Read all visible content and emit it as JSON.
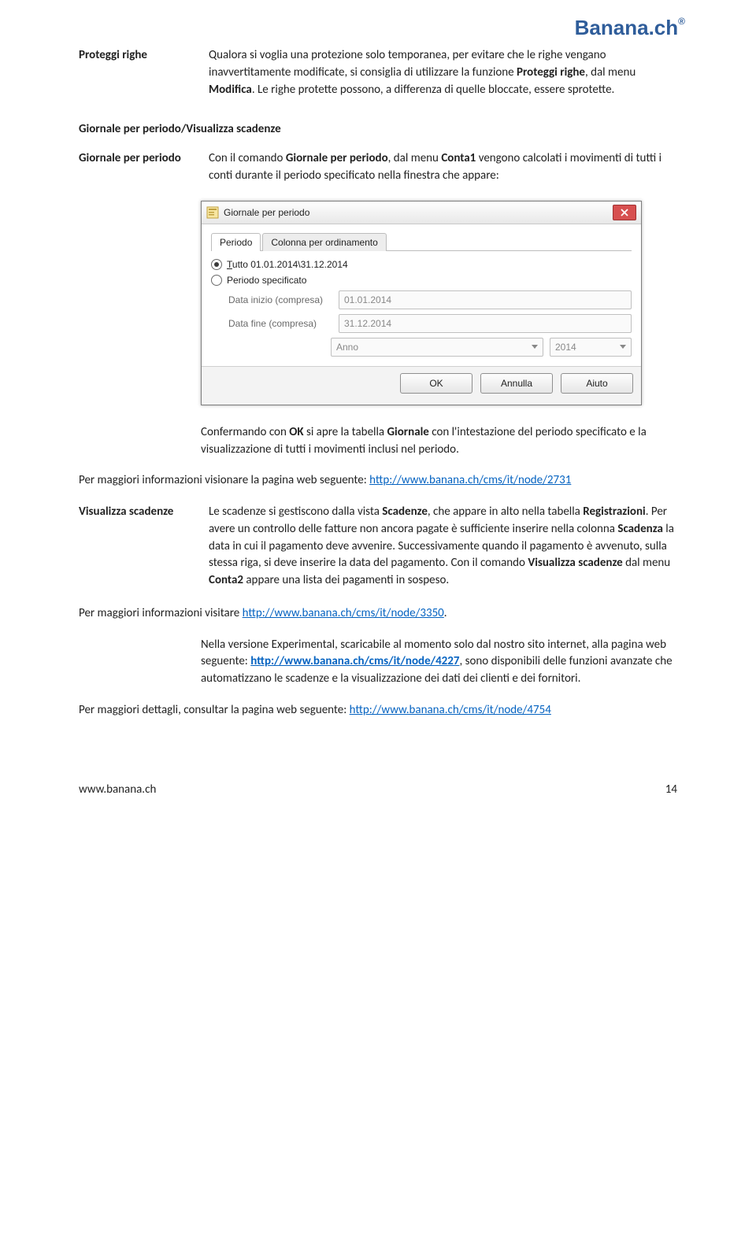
{
  "brand": {
    "name": "Banana.ch",
    "reg": "®"
  },
  "entry1": {
    "label": "Proteggi righe",
    "body_a": "Qualora si voglia una protezione solo temporanea, per evitare che le righe vengano inavvertitamente modificate, si consiglia di utilizzare la funzione ",
    "bold_a": "Proteggi righe",
    "body_b": ", dal menu ",
    "bold_b": "Modifica",
    "body_c": ". Le righe protette possono, a differenza di quelle bloccate, essere sprotette."
  },
  "section_title": "Giornale per periodo/Visualizza scadenze",
  "entry2": {
    "label": "Giornale per periodo",
    "a": "Con il comando ",
    "b1": "Giornale per periodo",
    "b": ", dal menu ",
    "b2": "Conta1",
    "c": " vengono calcolati i movimenti di tutti i conti durante il periodo specificato nella finestra che appare:"
  },
  "dialog": {
    "title": "Giornale per periodo",
    "tab1": "Periodo",
    "tab2": "Colonna per ordinamento",
    "radio_tutto_prefix": "T",
    "radio_tutto_rest": "utto 01.01.2014\\31.12.2014",
    "radio_periodo": "Periodo specificato",
    "data_inizio_label": "Data inizio (compresa)",
    "data_inizio_value": "01.01.2014",
    "data_fine_label": "Data fine (compresa)",
    "data_fine_value": "31.12.2014",
    "combo_period": "Anno",
    "combo_year": "2014",
    "ok": "OK",
    "annulla": "Annulla",
    "aiuto": "Aiuto"
  },
  "after_dialog": {
    "a": "Confermando con ",
    "b1": "OK",
    "b": " si apre la tabella ",
    "b2": "Giornale",
    "c": " con l'intestazione del periodo specificato e la visualizzazione di tutti i movimenti inclusi nel periodo."
  },
  "info_line1": {
    "pre": "Per maggiori informazioni visionare la pagina web seguente: ",
    "link": "http://www.banana.ch/cms/it/node/2731"
  },
  "entry3": {
    "label": "Visualizza scadenze",
    "a": "Le scadenze si gestiscono dalla vista ",
    "b1": "Scadenze",
    "b": ", che appare in alto nella tabella ",
    "b2": "Registrazioni",
    "c": ". Per avere un controllo delle fatture non ancora pagate è sufficiente inserire nella colonna ",
    "b3": "Scadenza",
    "d": " la data in cui il pagamento deve avvenire. Successivamente quando il pagamento è avvenuto, sulla stessa riga, si deve inserire la data del pagamento. Con il comando ",
    "b4": "Visualizza scadenze",
    "e": " dal menu ",
    "b5": "Conta2",
    "f": " appare una lista dei pagamenti in sospeso."
  },
  "info_line2": {
    "pre": "Per maggiori informazioni visitare ",
    "link": "http://www.banana.ch/cms/it/node/3350",
    "suf": "."
  },
  "experimental": {
    "a": "Nella versione Experimental, scaricabile al momento solo dal nostro sito internet, alla pagina web seguente: ",
    "link": "http://www.banana.ch/cms/it/node/4227",
    "b": ", sono disponibili delle funzioni avanzate che automatizzano le scadenze e la visualizzazione dei dati dei clienti e dei fornitori."
  },
  "info_line3": {
    "pre": "Per maggiori dettagli, consultar la pagina web seguente: ",
    "link": "http://www.banana.ch/cms/it/node/4754"
  },
  "footer": {
    "site": "www.banana.ch",
    "page": "14"
  }
}
